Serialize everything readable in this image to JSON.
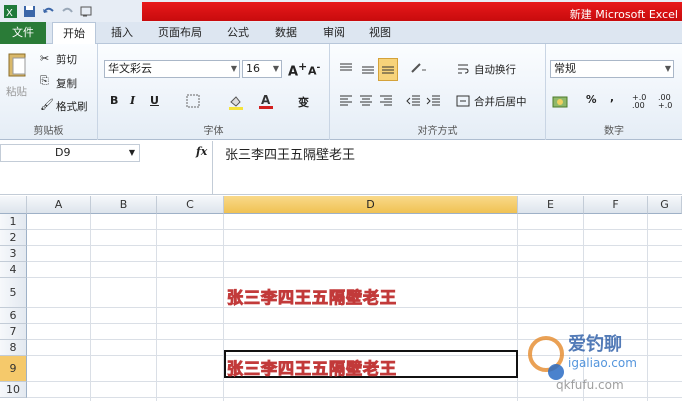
{
  "window": {
    "title": "新建 Microsoft Excel"
  },
  "tabs": [
    "文件",
    "开始",
    "插入",
    "页面布局",
    "公式",
    "数据",
    "审阅",
    "视图"
  ],
  "clipboard": {
    "paste": "粘贴",
    "cut": "剪切",
    "copy": "复制",
    "format_painter": "格式刷",
    "label": "剪贴板"
  },
  "font": {
    "name": "华文彩云",
    "size": "16",
    "bold": "B",
    "italic": "I",
    "underline": "U",
    "label": "字体",
    "phonetic": "变"
  },
  "alignment": {
    "wrap": "自动换行",
    "merge": "合并后居中",
    "label": "对齐方式"
  },
  "number": {
    "format": "常规",
    "percent": "%",
    "comma": ",",
    "inc_decimal": "+.0 .00",
    "dec_decimal": ".00 +.0",
    "label": "数字"
  },
  "formula_bar": {
    "name_box": "D9",
    "fx": "fx",
    "content": "张三李四王五隔壁老王"
  },
  "columns": [
    "A",
    "B",
    "C",
    "D",
    "E",
    "F",
    "G"
  ],
  "rows": [
    "1",
    "2",
    "3",
    "4",
    "5",
    "6",
    "7",
    "8",
    "9",
    "10"
  ],
  "selected": {
    "column": "D",
    "row": "9"
  },
  "cells": {
    "D5": "张三李四王五隔壁老王",
    "D9": "张三李四王五隔壁老王"
  },
  "watermark": {
    "brand": "爱钓聊",
    "url": "igaliao.com",
    "url2": "qkfufu.com"
  },
  "colors": {
    "file_tab": "#2a7b37",
    "title_bar": "#e8191b",
    "selection_header": "#f0c253",
    "cell_text": "#c23a3a"
  }
}
